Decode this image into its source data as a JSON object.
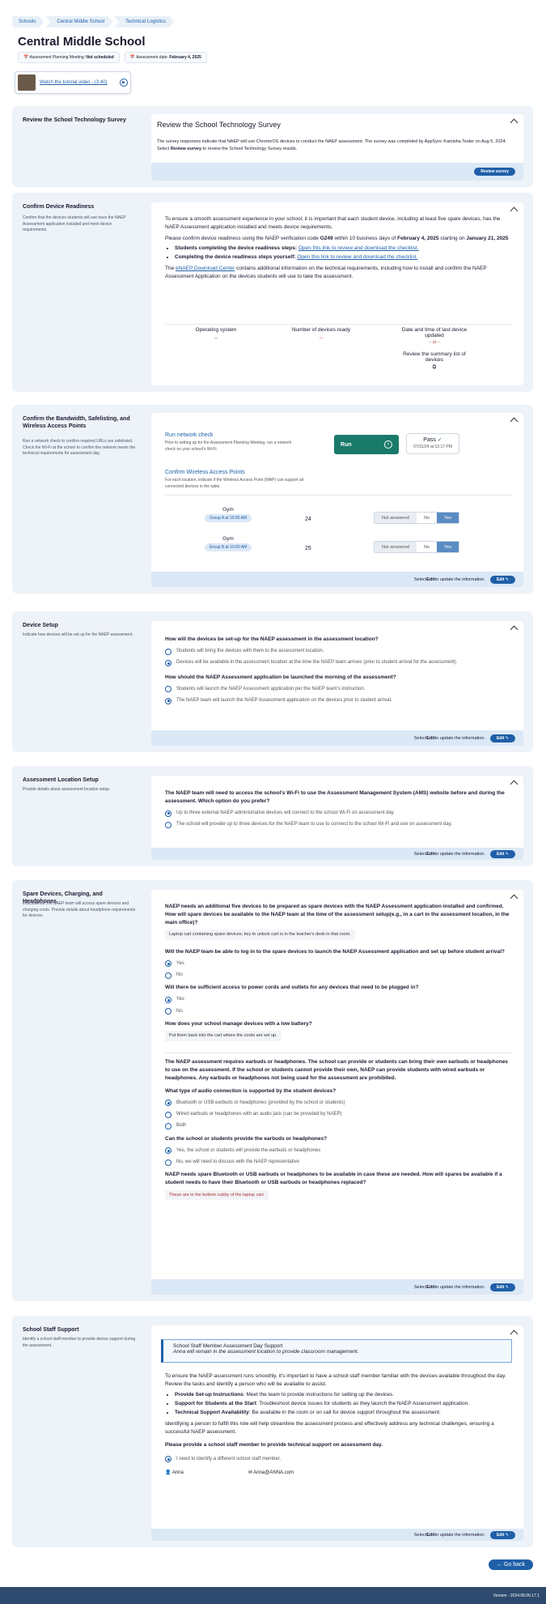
{
  "breadcrumbs": [
    "Schools",
    "Central Middle School",
    "Technical Logistics"
  ],
  "page_title": "Central Middle School",
  "meta": [
    {
      "label": "Assessment Planning Meeting:",
      "value": "Not scheduled"
    },
    {
      "label": "Assessment date:",
      "value": "February 4, 2025"
    }
  ],
  "tutorial": {
    "label": "Watch the tutorial video - (3:40)"
  },
  "survey": {
    "heading": "Review the School Technology Survey",
    "card_title": "Review the School Technology Survey",
    "text_pre": "The survey responses indicate that NAEP will use ChromeOS devices to conduct the NAEP assessment. The survey was completed by AppSync Kamisha Tester on Aug 5, 2024. Select ",
    "text_bold": "Review survey",
    "text_post": " to review the School Technology Survey results.",
    "button": "Review survey"
  },
  "device_readiness": {
    "heading": "Confirm Device Readiness",
    "desc": "Confirm that the devices students will use have the NAEP Assessment application installed and meet device requirements.",
    "p1": "To ensure a smooth assessment experience in your school, it is important that each student device, including at least five spare devices, has the NAEP Assessment application installed and meets device requirements.",
    "p2_pre": "Please confirm device readiness using the NAEP verification code ",
    "p2_code": "G249",
    "p2_mid": " within 10 business days of ",
    "p2_date": "February 4, 2025",
    "p2_mid2": " starting on ",
    "p2_start": "January 21, 2025",
    "bullets": [
      {
        "bold": "Students completing the device readiness steps:",
        "link": "Open this link to review and download the checklist."
      },
      {
        "bold": "Completing the device readiness steps yourself:",
        "link": "Open this link to review and download the checklist."
      }
    ],
    "p3_pre": "The ",
    "p3_link": "eNAEP Download Center",
    "p3_post": " contains additional information on the technical requirements, including how to install and confirm the NAEP Assessment Application on the devices students will use to take the assessment.",
    "col1": "Operating system",
    "col2": "Number of devices ready",
    "col3": "Date and time of last device updated",
    "dash": "--",
    "col3_value": "-- at --",
    "summary": "Review the summary list of devices"
  },
  "bandwidth": {
    "heading": "Confirm the Bandwidth, Safelisting, and Wireless Access Points",
    "desc": "Run a network check to confirm required URLs are safelisted. Check the Wi-Fi at the school to confirm the network meets the technical requirements for assessment day.",
    "run_title": "Run network check",
    "run_desc": "Prior to setting up for the Assessment Planning Meeting, run a network check on your school's Wi-Fi.",
    "run_button": "Run",
    "pass_label": "Pass",
    "pass_date": "07/31/24 at 12:17 PM",
    "wap_title": "Confirm Wireless Access Points",
    "wap_desc": "For each location, indicate if the Wireless Access Point (WAP) can support all connected devices in the table.",
    "rows": [
      {
        "location": "Gym",
        "group": "Group A at 10:00 AM",
        "count": "24",
        "opts": [
          "Not answered",
          "No",
          "Yes"
        ]
      },
      {
        "location": "Gym",
        "group": "Group B at 10:00 AM",
        "count": "25",
        "opts": [
          "Not answered",
          "No",
          "Yes"
        ]
      }
    ],
    "footer_pre": "Select ",
    "footer_bold": "Edit",
    "footer_post": " to update the information.",
    "edit": "Edit"
  },
  "device_setup": {
    "heading": "Device Setup",
    "desc": "Indicate how devices will be set up for the NAEP assessment.",
    "q1": "How will the devices be set-up for the NAEP assessment in the assessment location?",
    "q1_opts": [
      "Students will bring the devices with them to the assessment location.",
      "Devices will be available in the assessment location at the time the NAEP team arrives (prior to student arrival for the assessment)."
    ],
    "q2": "How should the NAEP Assessment application be launched the morning of the assessment?",
    "q2_opts": [
      "Students will launch the NAEP Assessment application per the NAEP team's instruction.",
      "The NAEP team will launch the NAEP Assessment application on the devices prior to student arrival."
    ],
    "footer_pre": "Select ",
    "footer_bold": "Edit",
    "footer_post": " to update the information.",
    "edit": "Edit"
  },
  "location_setup": {
    "heading": "Assessment Location Setup",
    "desc": "Provide details about assessment location setup.",
    "q1": "The NAEP team will need to access the school's Wi-Fi to use the Assessment Management System (AMS) website before and during the assessment. Which option do you prefer?",
    "q1_opts": [
      "Up to three external NAEP administrative devices will connect to the school Wi-Fi on assessment day.",
      "The school will provide up to three devices for the NAEP team to use to connect to the school Wi-Fi and use on assessment day."
    ],
    "footer_pre": "Select ",
    "footer_bold": "Edit",
    "footer_post": " to update the information.",
    "edit": "Edit"
  },
  "spare": {
    "heading": "Spare Devices, Charging, and Headphones",
    "desc": "Indicate how the NAEP team will access spare devices and charging cords. Provide details about headphone requirements for devices.",
    "q1": "NAEP needs an additional five devices to be prepared as spare devices with the NAEP Assessment application installed and confirmed. How will spare devices be available to the NAEP team at the time of the assessment setup(e.g., in a cart in the assessment location, in the main office)?",
    "a1": "Laptop cart containing spare devices; key to unlock cart is in the teacher's desk in that room.",
    "q2": "Will the NAEP team be able to log in to the spare devices to launch the NAEP Assessment application and set up before student arrival?",
    "q2_opts": [
      "Yes",
      "No"
    ],
    "q3": "Will there be sufficient access to power cords and outlets for any devices that need to be plugged in?",
    "q3_opts": [
      "Yes",
      "No"
    ],
    "q4": "How does your school manage devices with a low battery?",
    "a4": "Put them back into the cart where the cords are set up.",
    "p_head": "The NAEP assessment requires earbuds or headphones. The school can provide or students can bring their own earbuds or headphones to use on the assessment. If the school or students cannot provide their own, NAEP can provide students with wired earbuds or headphones. Any earbuds or headphones not being used for the assessment are prohibited.",
    "q5": "What type of audio connection is supported by the student devices?",
    "q5_opts": [
      "Bluetooth or USB earbuds or headphones (provided by the school or students)",
      "Wired earbuds or headphones with an audio jack (can be provided by NAEP)",
      "Both"
    ],
    "q6": "Can the school or students provide the earbuds or headphones?",
    "q6_opts": [
      "Yes, the school or students will provide the earbuds or headphones",
      "No, we will need to discuss with the NAEP representative"
    ],
    "q7": "NAEP needs spare Bluetooth or USB earbuds or headphones to be available in case these are needed. How will spares be available if a student needs to have their Bluetooth or USB earbuds or headphones replaced?",
    "a7": "These are in the bottom cubby of the laptop cart.",
    "footer_pre": "Select ",
    "footer_bold": "Edit",
    "footer_post": " to update the information.",
    "edit": "Edit"
  },
  "staff": {
    "heading": "School Staff Support",
    "desc": "Identify a school staff member to provide device support during the assessment.",
    "box_title": "School Staff Member Assessment Day Support",
    "box_text": "Anna will remain in the assessment location to provide classroom management.",
    "p1": "To ensure the NAEP assessment runs smoothly, it's important to have a school staff member familiar with the devices available throughout the day. Review the tasks and identify a person who will be available to assist.",
    "bullets": [
      {
        "bold": "Provide Set-up Instructions",
        "text": ": Meet the team to provide instructions for setting up the devices."
      },
      {
        "bold": "Support for Students at the Start",
        "text": ": Troubleshoot device issues for students as they launch the NAEP Assessment application."
      },
      {
        "bold": "Technical Support Availability",
        "text": ": Be available in the room or on call for device support throughout the assessment."
      }
    ],
    "p2": "Identifying a person to fulfill this role will help streamline the assessment process and effectively address any technical challenges, ensuring a successful NAEP assessment.",
    "q1": "Please provide a school staff member to provide technical support on assessment day.",
    "q1_opt": "I need to identify a different school staff member.",
    "person_name": "Anna",
    "person_email": "Anna@ANNA.com",
    "footer_pre": "Select ",
    "footer_bold": "Edit",
    "footer_post": " to update the information.",
    "edit": "Edit"
  },
  "back": "Go back",
  "version": "Version - 2024.08.06.17.1"
}
